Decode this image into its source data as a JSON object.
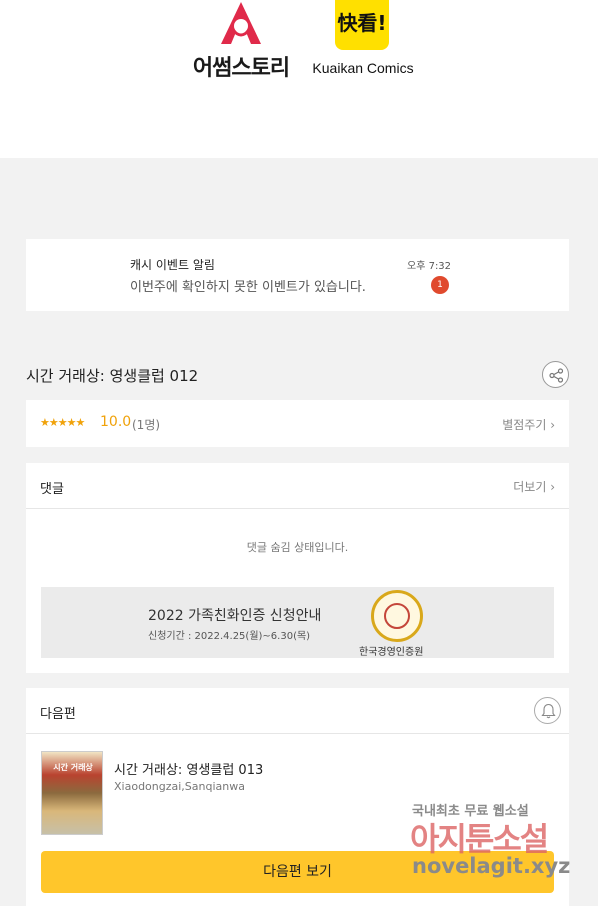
{
  "header": {
    "brand_left": "어썸스토리",
    "brand_right_mark": "快看!",
    "brand_right": "Kuaikan Comics"
  },
  "notification": {
    "title": "캐시 이벤트 알림",
    "message": "이번주에 확인하지 못한 이벤트가 있습니다.",
    "time": "오후 7:32",
    "badge": "1"
  },
  "episode": {
    "title": "시간 거래상: 영생클럽 012"
  },
  "rating": {
    "stars": "★★★★★",
    "score": "10.0",
    "count": "(1명)",
    "action_label": "별점주기 ›"
  },
  "comments": {
    "title": "댓글",
    "more_label": "더보기 ›",
    "hidden_notice": "댓글 숨김 상태입니다.",
    "banner": {
      "title": "2022 가족친화인증 신청안내",
      "subtitle": "신청기간 : 2022.4.25(월)~6.30(목)",
      "org": "한국경영인증원"
    }
  },
  "next": {
    "title": "다음편",
    "thumb_label": "시간 거래상",
    "episode_title": "시간 거래상: 영생클럽 013",
    "authors": "Xiaodongzai,Sanqianwa",
    "button_label": "다음편 보기"
  },
  "watermark": {
    "line1": "국내최초 무료 웹소설",
    "line2": "아지툰소설",
    "line3": "novelagit.xyz"
  },
  "colors": {
    "accent_yellow": "#ffc62b",
    "star": "#f0a20a",
    "badge_red": "#e04a2e",
    "kuaikan_yellow": "#ffe000"
  }
}
